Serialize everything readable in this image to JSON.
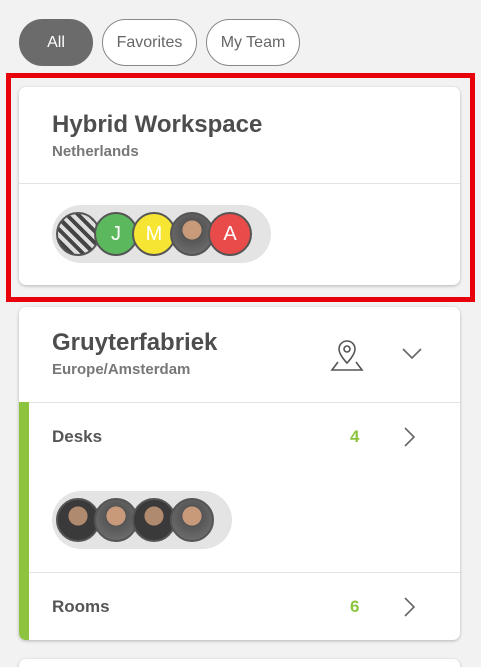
{
  "filters": {
    "all": "All",
    "favorites": "Favorites",
    "my_team": "My Team"
  },
  "card1": {
    "title": "Hybrid Workspace",
    "subtitle": "Netherlands",
    "avatars": [
      "J",
      "M",
      "A"
    ]
  },
  "card2": {
    "title": "Gruyterfabriek",
    "subtitle": "Europe/Amsterdam",
    "desks_label": "Desks",
    "desks_count": "4",
    "rooms_label": "Rooms",
    "rooms_count": "6"
  },
  "colors": {
    "accent_green": "#8cc43f",
    "highlight_red": "#e8000b"
  }
}
